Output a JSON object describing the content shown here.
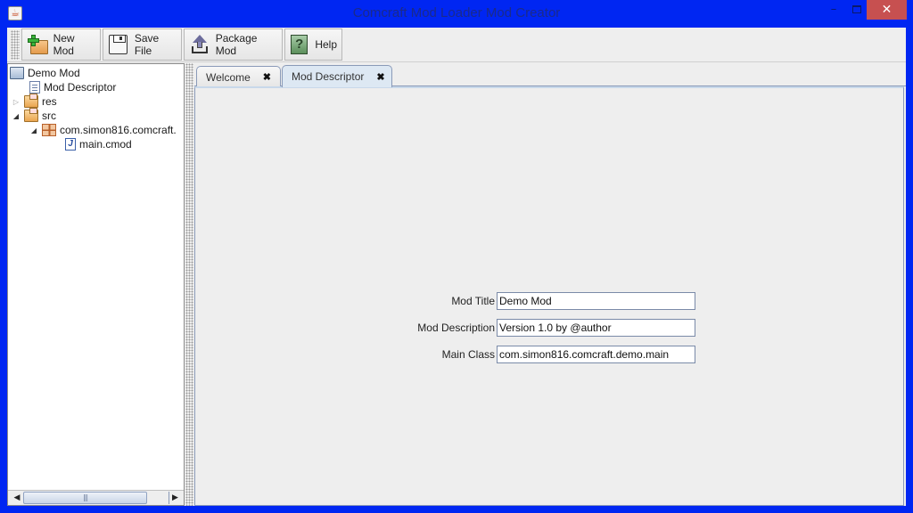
{
  "window": {
    "title": "Comcraft Mod Loader Mod Creator",
    "app_icon": "java-cup-icon",
    "controls": {
      "minimize": "–",
      "maximize": "□",
      "close": "✕"
    }
  },
  "toolbar": {
    "buttons": [
      {
        "label": "New Mod",
        "icon": "new-folder-icon"
      },
      {
        "label": "Save File",
        "icon": "floppy-disk-icon"
      },
      {
        "label": "Package Mod",
        "icon": "upload-icon"
      },
      {
        "label": "Help",
        "icon": "help-icon",
        "glyph": "?"
      }
    ]
  },
  "tree": {
    "nodes": [
      {
        "label": "Demo Mod",
        "icon": "open-folder-icon",
        "expander": ""
      },
      {
        "label": "Mod Descriptor",
        "icon": "document-icon",
        "expander": ""
      },
      {
        "label": "res",
        "icon": "folder-icon",
        "expander": "▷"
      },
      {
        "label": "src",
        "icon": "folder-icon",
        "expander": "◢"
      },
      {
        "label": "com.simon816.comcraft.",
        "icon": "package-icon",
        "expander": "◢"
      },
      {
        "label": "main.cmod",
        "icon": "java-file-icon",
        "glyph": "J",
        "expander": ""
      }
    ],
    "scrollbar": {
      "left": "◀",
      "right": "▶",
      "grip": "|||"
    }
  },
  "tabs": [
    {
      "label": "Welcome",
      "close": "✖",
      "active": false
    },
    {
      "label": "Mod Descriptor",
      "close": "✖",
      "active": true
    }
  ],
  "form": {
    "fields": [
      {
        "label": "Mod Title",
        "value": "Demo Mod"
      },
      {
        "label": "Mod Description",
        "value": "Version 1.0 by @author"
      },
      {
        "label": "Main Class",
        "value": "com.simon816.comcraft.demo.main"
      }
    ]
  }
}
